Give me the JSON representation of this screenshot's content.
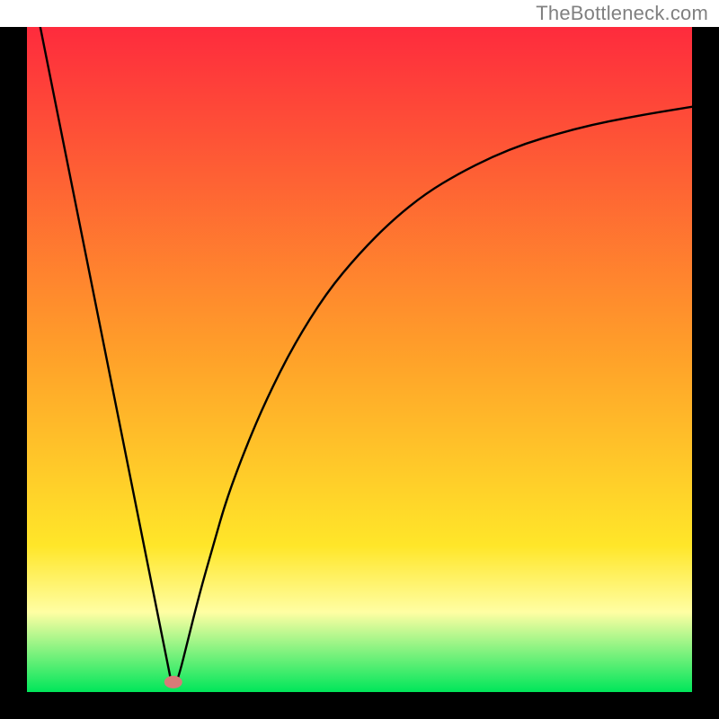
{
  "attribution": "TheBottleneck.com",
  "chart_data": {
    "type": "line",
    "title": "",
    "xlabel": "",
    "ylabel": "",
    "xlim": [
      0,
      100
    ],
    "ylim": [
      0,
      100
    ],
    "grid": false,
    "background_gradient": {
      "top": "#fe2b3d",
      "mid_upper": "#ffa229",
      "mid": "#ffe629",
      "lower": "#fffea3",
      "bottom": "#00e65a",
      "stops_pct": [
        0,
        50,
        78,
        88,
        100
      ]
    },
    "minimum_marker": {
      "x": 22,
      "y": 1.5,
      "color": "#d87a78"
    },
    "series": [
      {
        "name": "curve",
        "x": [
          2,
          4,
          6,
          8,
          10,
          12,
          14,
          16,
          18,
          20,
          21,
          22,
          23,
          24,
          26,
          28,
          30,
          33,
          36,
          40,
          45,
          50,
          55,
          60,
          65,
          70,
          75,
          80,
          85,
          90,
          95,
          100
        ],
        "y": [
          100,
          90,
          80,
          70,
          60,
          50,
          40,
          30,
          20,
          10,
          5,
          0,
          3,
          7,
          15,
          22,
          29,
          37,
          44,
          52,
          60,
          66,
          71,
          75,
          78,
          80.5,
          82.5,
          84,
          85.3,
          86.3,
          87.2,
          88
        ]
      }
    ]
  }
}
